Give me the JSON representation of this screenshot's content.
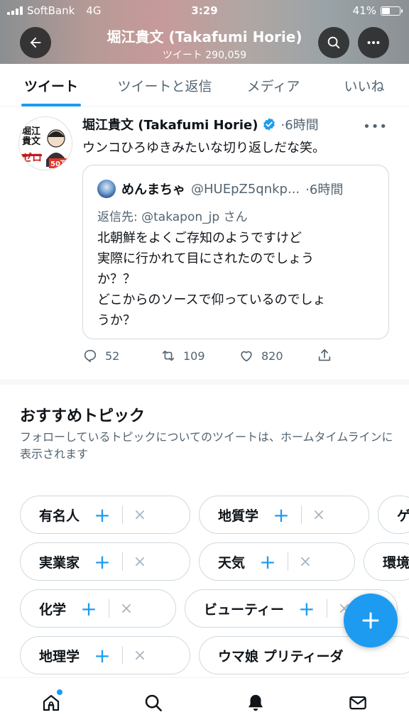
{
  "status_bar": {
    "carrier": "SoftBank",
    "network": "4G",
    "time": "3:29",
    "battery": "41%",
    "battery_level": 0.41
  },
  "header": {
    "name": "堀江貴文 (Takafumi Horie)",
    "tweet_count": "ツイート 290,059"
  },
  "tabs": [
    {
      "label": "ツイート",
      "active": true
    },
    {
      "label": "ツイートと返信",
      "active": false
    },
    {
      "label": "メディア",
      "active": false
    },
    {
      "label": "いいね",
      "active": false
    }
  ],
  "tweet": {
    "name": "堀江貴文 (Takafumi Horie)",
    "time": "·6時間",
    "text": "ウンコひろゆきみたいな切り返しだな笑。",
    "quote": {
      "name": "めんまちゃ",
      "handle": "@HUEpZ5qnkp...",
      "time": "·6時間",
      "reply_prefix": "返信先:",
      "reply_to": "@takapon_jp",
      "reply_suffix": "さん",
      "lines": [
        "北朝鮮をよくご存知のようですけど",
        "実際に行かれて目にされたのでしょう",
        "か？？",
        "どこからのソースで仰っているのでしょ",
        "うか？"
      ]
    },
    "actions": {
      "replies": "52",
      "retweets": "109",
      "likes": "820"
    }
  },
  "topics": {
    "title": "おすすめトピック",
    "description": "フォローしているトピックについてのツイートは、ホームタイムラインに表示されます",
    "chips": [
      "有名人",
      "地質学",
      "ゲ",
      "実業家",
      "天気",
      "環境",
      "化学",
      "ビューティー",
      "地理学",
      "ウマ娘 プリティーダ"
    ]
  },
  "colors": {
    "accent": "#1d9bf0",
    "text": "#0f1419",
    "muted": "#536471"
  },
  "bottom_nav": [
    "home-icon",
    "search-icon",
    "notifications-icon",
    "messages-icon"
  ]
}
